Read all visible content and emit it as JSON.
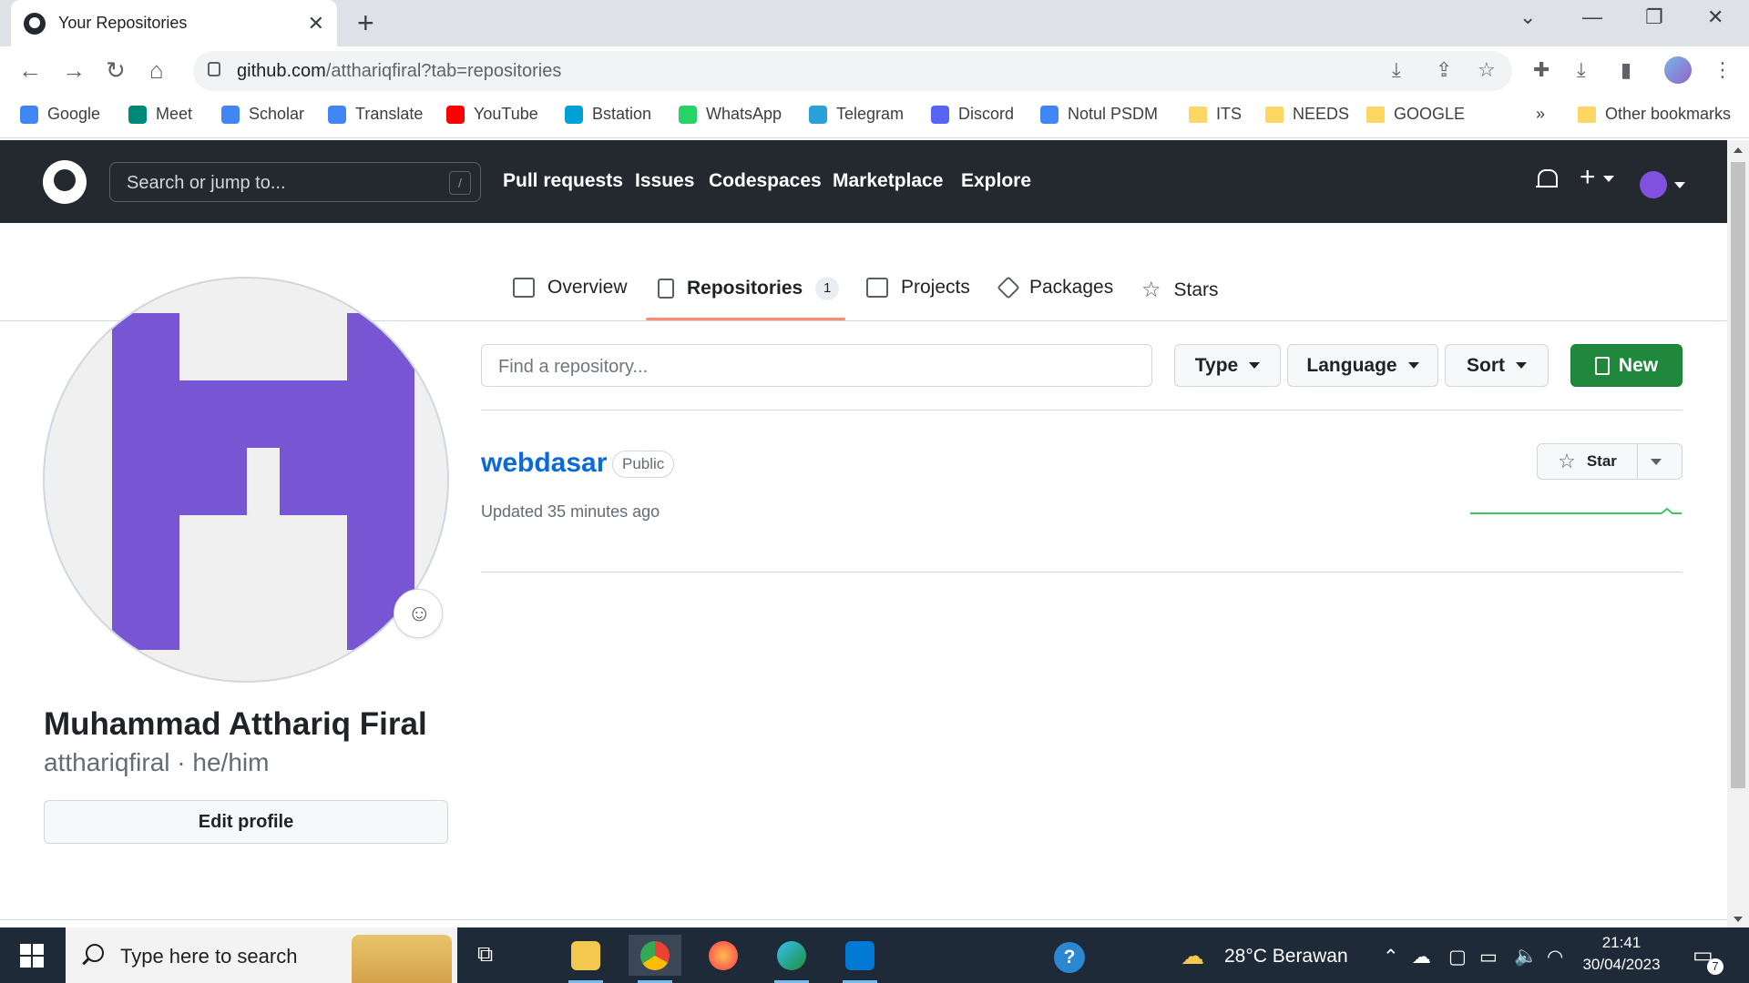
{
  "browser": {
    "tab_title": "Your Repositories",
    "tab_close": "✕",
    "new_tab": "+",
    "url_host": "github.com",
    "url_path": "/atthariqfiral?tab=repositories",
    "bookmarks": [
      {
        "label": "Google",
        "color": "#4285f4"
      },
      {
        "label": "Meet",
        "color": "#00897b"
      },
      {
        "label": "Scholar",
        "color": "#4285f4"
      },
      {
        "label": "Translate",
        "color": "#4285f4"
      },
      {
        "label": "YouTube",
        "color": "#ff0000"
      },
      {
        "label": "Bstation",
        "color": "#00a1d6"
      },
      {
        "label": "WhatsApp",
        "color": "#25d366"
      },
      {
        "label": "Telegram",
        "color": "#2aa1da"
      },
      {
        "label": "Discord",
        "color": "#5865f2"
      },
      {
        "label": "Notul PSDM",
        "color": "#4285f4"
      },
      {
        "label": "ITS",
        "color": "folder"
      },
      {
        "label": "NEEDS",
        "color": "folder"
      },
      {
        "label": "GOOGLE",
        "color": "folder"
      }
    ],
    "bookmarks_overflow": "»",
    "other_bookmarks": "Other bookmarks"
  },
  "github": {
    "search_placeholder": "Search or jump to...",
    "search_shortcut": "/",
    "nav": [
      "Pull requests",
      "Issues",
      "Codespaces",
      "Marketplace",
      "Explore"
    ],
    "plus_label": "+"
  },
  "profile_tabs": [
    {
      "label": "Overview",
      "icon": "book-icon"
    },
    {
      "label": "Repositories",
      "icon": "repo-icon",
      "count": "1",
      "active": true
    },
    {
      "label": "Projects",
      "icon": "table-icon"
    },
    {
      "label": "Packages",
      "icon": "package-icon"
    },
    {
      "label": "Stars",
      "icon": "star-icon"
    }
  ],
  "profile": {
    "full_name": "Muhammad Atthariq Firal",
    "username_line": "atthariqfiral · he/him",
    "edit_button": "Edit profile",
    "avatar_color": "#7856d3"
  },
  "repo_filters": {
    "find_placeholder": "Find a repository...",
    "type": "Type",
    "language": "Language",
    "sort": "Sort",
    "new": "New",
    "new_color": "#1f883d"
  },
  "repos": [
    {
      "name": "webdasar",
      "visibility": "Public",
      "updated": "Updated 35 minutes ago",
      "star_label": "Star"
    }
  ],
  "taskbar": {
    "search_placeholder": "Type here to search",
    "weather": "28°C  Berawan",
    "time": "21:41",
    "date": "30/04/2023",
    "notification_count": "7"
  }
}
